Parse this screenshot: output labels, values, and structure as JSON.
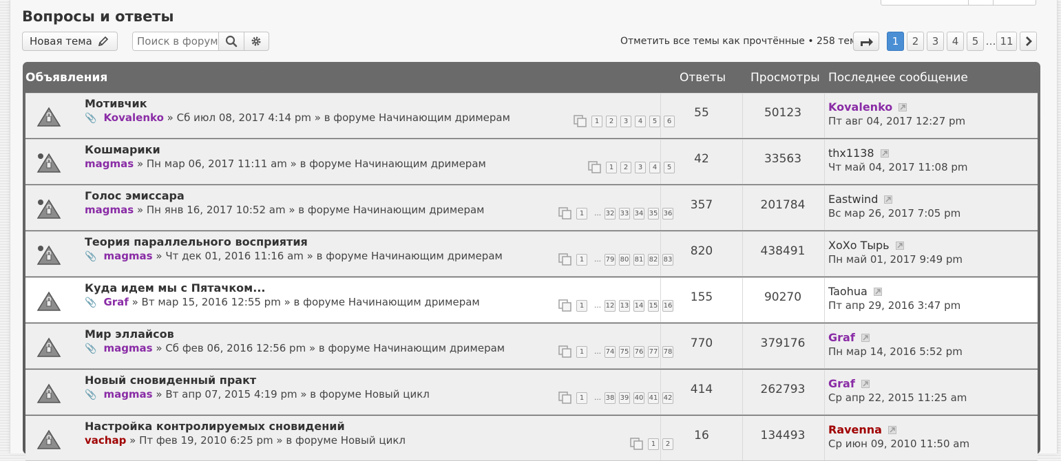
{
  "header": {
    "title": "Вопросы и ответы",
    "new_topic": "Новая тема",
    "search_placeholder": "Поиск в форуме",
    "mark_read": "Отметить все темы как прочтённые",
    "topic_count": "• 258 тем",
    "pagination": [
      "1",
      "2",
      "3",
      "4",
      "5",
      "…",
      "11"
    ],
    "current_page": "1"
  },
  "table": {
    "section": "Объявления",
    "col_replies": "Ответы",
    "col_views": "Просмотры",
    "col_last": "Последнее сообщение"
  },
  "topics": [
    {
      "title": "Мотивчик",
      "attach": true,
      "author": "Kovalenko",
      "author_color": "purple",
      "posted": "» Сб июл 08, 2017 4:14 pm » в форуме Начинающим дримерам",
      "pages": [
        "1",
        "2",
        "3",
        "4",
        "5",
        "6"
      ],
      "replies": "55",
      "views": "50123",
      "last_author": "Kovalenko",
      "last_color": "purple",
      "last_date": "Пт авг 04, 2017 12:27 pm"
    },
    {
      "title": "Кошмарики",
      "attach": false,
      "author": "magmas",
      "author_color": "purple",
      "posted": "» Пн мар 06, 2017 11:11 am » в форуме Начинающим дримерам",
      "pages": [
        "1",
        "2",
        "3",
        "4",
        "5"
      ],
      "replies": "42",
      "views": "33563",
      "last_author": "thx1138",
      "last_color": "dark",
      "last_date": "Чт май 04, 2017 11:08 pm"
    },
    {
      "title": "Голос эмиссара",
      "attach": false,
      "author": "magmas",
      "author_color": "purple",
      "posted": "» Пн янв 16, 2017 10:52 am » в форуме Начинающим дримерам",
      "pages": [
        "1",
        "…",
        "32",
        "33",
        "34",
        "35",
        "36"
      ],
      "replies": "357",
      "views": "201784",
      "last_author": "Eastwind",
      "last_color": "dark",
      "last_date": "Вс мар 26, 2017 7:05 pm"
    },
    {
      "title": "Теория параллельного восприятия",
      "attach": true,
      "author": "magmas",
      "author_color": "purple",
      "posted": "» Чт дек 01, 2016 11:16 am » в форуме Начинающим дримерам",
      "pages": [
        "1",
        "…",
        "79",
        "80",
        "81",
        "82",
        "83"
      ],
      "replies": "820",
      "views": "438491",
      "last_author": "XoXo Тырь",
      "last_color": "dark",
      "last_date": "Пн май 01, 2017 9:49 pm"
    },
    {
      "title": "Куда идем мы с Пятачком...",
      "attach": true,
      "author": "Graf",
      "author_color": "purple",
      "posted": "» Вт мар 15, 2016 12:55 pm » в форуме Начинающим дримерам",
      "pages": [
        "1",
        "…",
        "12",
        "13",
        "14",
        "15",
        "16"
      ],
      "replies": "155",
      "views": "90270",
      "last_author": "Taohua",
      "last_color": "dark",
      "last_date": "Пт апр 29, 2016 3:47 pm"
    },
    {
      "title": "Мир эллайсов",
      "attach": true,
      "author": "magmas",
      "author_color": "purple",
      "posted": "» Сб фев 06, 2016 12:56 pm » в форуме Начинающим дримерам",
      "pages": [
        "1",
        "…",
        "74",
        "75",
        "76",
        "77",
        "78"
      ],
      "replies": "770",
      "views": "379176",
      "last_author": "Graf",
      "last_color": "purple",
      "last_date": "Пн мар 14, 2016 5:52 pm"
    },
    {
      "title": "Новый сновиденный практ",
      "attach": true,
      "author": "magmas",
      "author_color": "purple",
      "posted": "» Вт апр 07, 2015 4:19 pm » в форуме Новый цикл",
      "pages": [
        "1",
        "…",
        "38",
        "39",
        "40",
        "41",
        "42"
      ],
      "replies": "414",
      "views": "262793",
      "last_author": "Graf",
      "last_color": "purple",
      "last_date": "Ср апр 22, 2015 11:25 am"
    },
    {
      "title": "Настройка контролируемых сновидений",
      "attach": false,
      "author": "vachap",
      "author_color": "red",
      "posted": "» Пт фев 19, 2010 6:25 pm » в форуме Новый цикл",
      "pages": [
        "1",
        "2"
      ],
      "replies": "16",
      "views": "134493",
      "last_author": "Ravenna",
      "last_color": "red",
      "last_date": "Ср июн 09, 2010 11:50 am"
    }
  ]
}
